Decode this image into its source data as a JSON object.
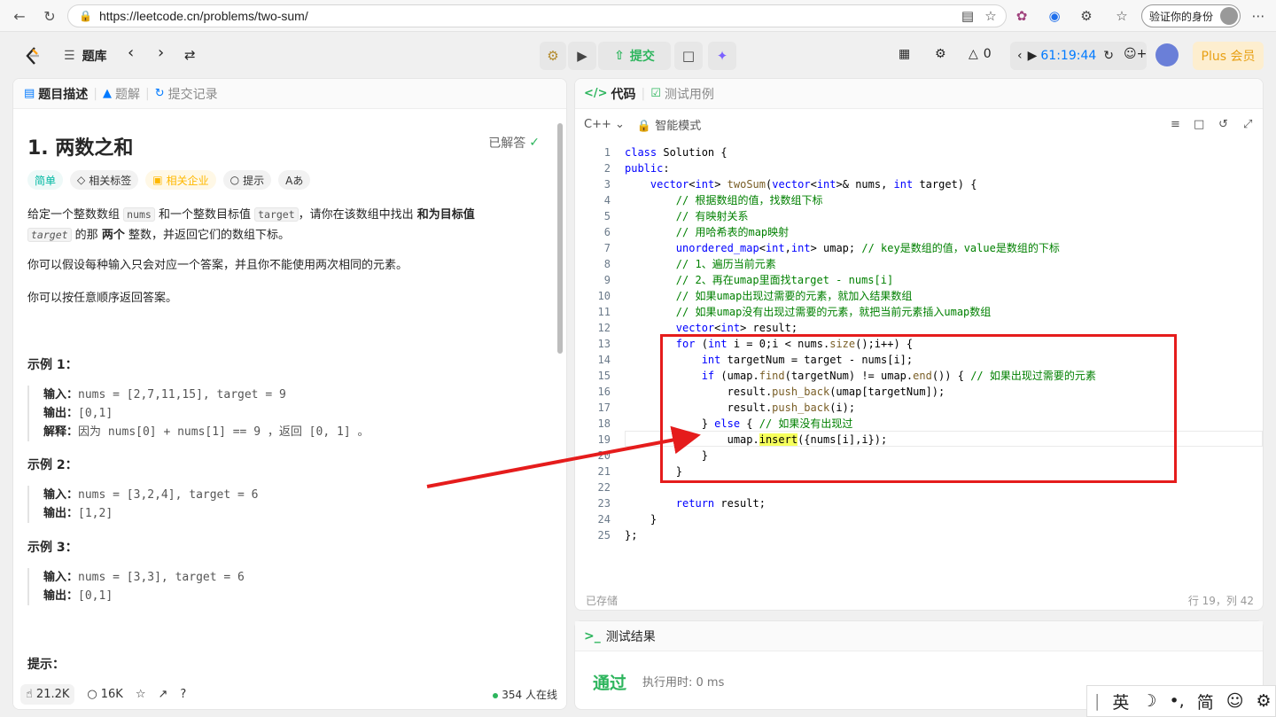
{
  "browser": {
    "url": "https://leetcode.cn/problems/two-sum/",
    "profile_label": "验证你的身份"
  },
  "topbar": {
    "problem_list": "题库",
    "submit": "提交",
    "fire_count": "0",
    "timer": "61:19:44",
    "plus": "Plus 会员"
  },
  "left": {
    "tabs": [
      "题目描述",
      "题解",
      "提交记录"
    ],
    "title": "1. 两数之和",
    "solved": "已解答",
    "tags": [
      "简单",
      "相关标签",
      "相关企业",
      "提示",
      "Aあ"
    ],
    "desc": {
      "p1a": "给定一个整数数组 ",
      "p1code1": "nums",
      "p1b": " 和一个整数目标值 ",
      "p1code2": "target",
      "p1c": "，请你在该数组中找出 ",
      "p1bold1": "和为目标值",
      "p1code3": "target",
      "p1d": " 的那 ",
      "p1bold2": "两个",
      "p1e": " 整数，并返回它们的数组下标。",
      "p2": "你可以假设每种输入只会对应一个答案，并且你不能使用两次相同的元素。",
      "p3": "你可以按任意顺序返回答案。"
    },
    "examples": [
      {
        "title": "示例 1：",
        "input_label": "输入：",
        "input": "nums = [2,7,11,15], target = 9",
        "output_label": "输出：",
        "output": "[0,1]",
        "explain_label": "解释：",
        "explain": "因为 nums[0] + nums[1] == 9 ，返回 [0, 1] 。"
      },
      {
        "title": "示例 2：",
        "input_label": "输入：",
        "input": "nums = [3,2,4], target = 6",
        "output_label": "输出：",
        "output": "[1,2]"
      },
      {
        "title": "示例 3：",
        "input_label": "输入：",
        "input": "nums = [3,3], target = 6",
        "output_label": "输出：",
        "output": "[0,1]"
      }
    ],
    "hint_title": "提示：",
    "likes": "21.2K",
    "comments": "16K",
    "online": "354 人在线"
  },
  "code": {
    "tabs": [
      "代码",
      "测试用例"
    ],
    "language": "C++",
    "mode": "智能模式",
    "status": "已存储",
    "cursor": "行 19，列 42",
    "lines": [
      "class Solution {",
      "public:",
      "    vector<int> twoSum(vector<int>& nums, int target) {",
      "        // 根据数组的值，找数组下标",
      "        // 有映射关系",
      "        // 用哈希表的map映射",
      "        unordered_map<int,int> umap; // key是数组的值，value是数组的下标",
      "        // 1、遍历当前元素",
      "        // 2、再在umap里面找target - nums[i]",
      "        // 如果umap出现过需要的元素，就加入结果数组",
      "        // 如果umap没有出现过需要的元素，就把当前元素插入umap数组",
      "        vector<int> result;",
      "        for (int i = 0;i < nums.size();i++) {",
      "            int targetNum = target - nums[i];",
      "            if (umap.find(targetNum) != umap.end()) { // 如果出现过需要的元素",
      "                result.push_back(umap[targetNum]);",
      "                result.push_back(i);",
      "            } else { // 如果没有出现过",
      "                umap.insert({nums[i],i});",
      "            }",
      "        }",
      "",
      "        return result;",
      "    }",
      "};"
    ]
  },
  "results": {
    "tab": "测试结果",
    "verdict": "通过",
    "runtime": "执行用时: 0 ms"
  },
  "ime": [
    "英",
    "简"
  ]
}
